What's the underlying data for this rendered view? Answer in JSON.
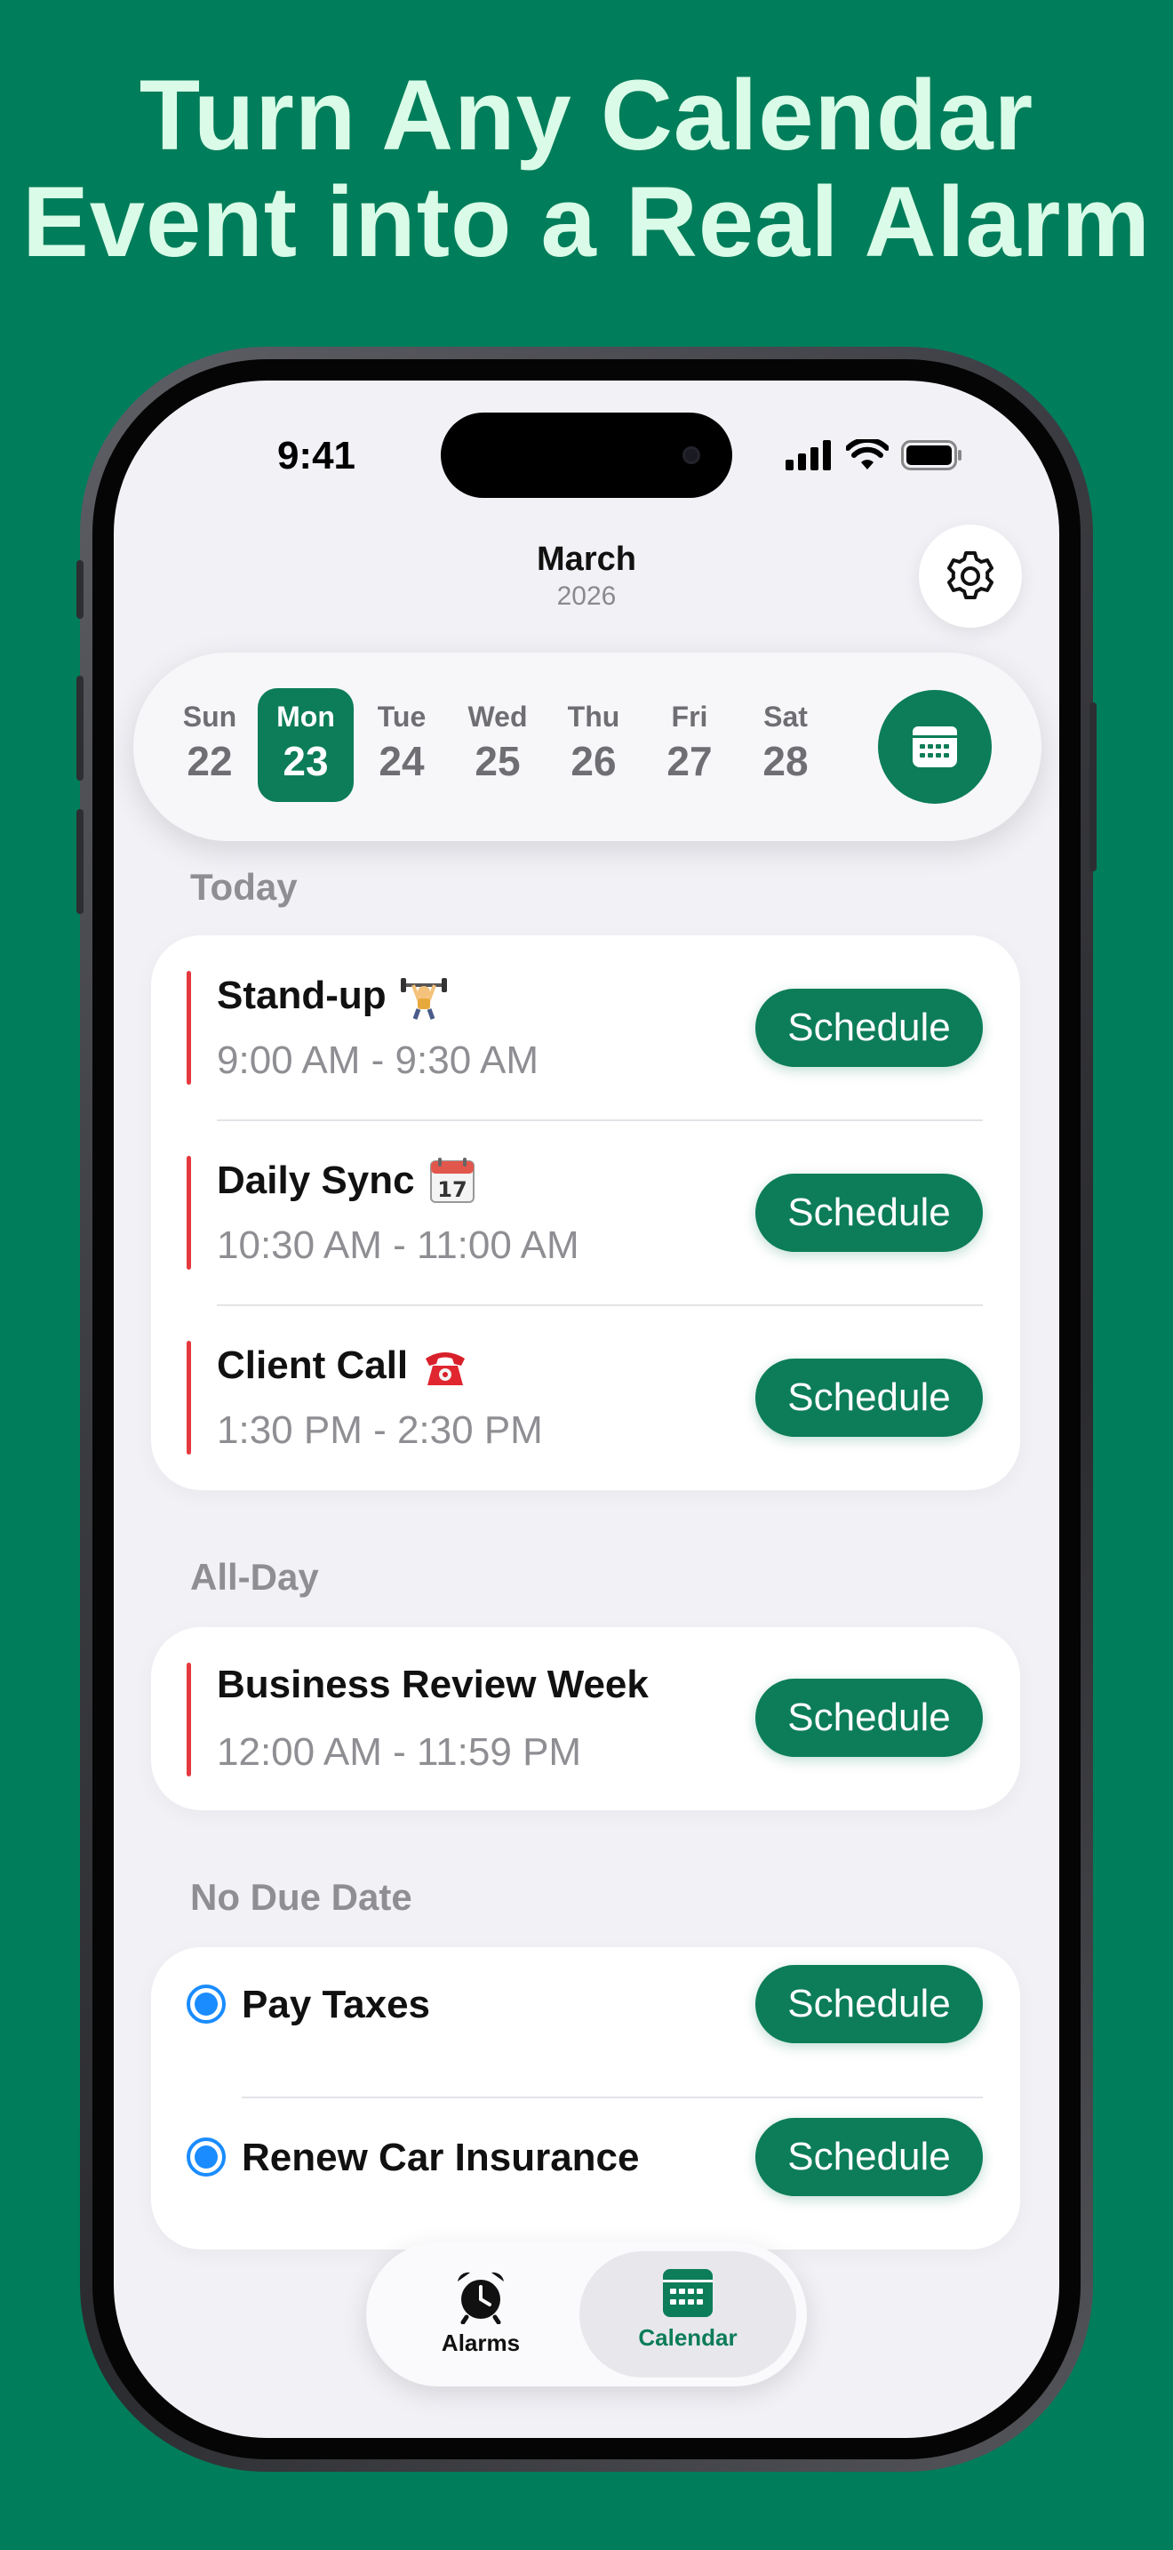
{
  "headline": {
    "line1": "Turn Any Calendar",
    "line2": "Event into a Real Alarm"
  },
  "status_bar": {
    "time": "9:41"
  },
  "header": {
    "month": "March",
    "year": "2026",
    "settings_icon": "gear-icon"
  },
  "week": {
    "days": [
      {
        "name": "Sun",
        "num": "22",
        "selected": false
      },
      {
        "name": "Mon",
        "num": "23",
        "selected": true
      },
      {
        "name": "Tue",
        "num": "24",
        "selected": false
      },
      {
        "name": "Wed",
        "num": "25",
        "selected": false
      },
      {
        "name": "Thu",
        "num": "26",
        "selected": false
      },
      {
        "name": "Fri",
        "num": "27",
        "selected": false
      },
      {
        "name": "Sat",
        "num": "28",
        "selected": false
      }
    ],
    "calendar_icon": "calendar-icon"
  },
  "sections": {
    "today": {
      "label": "Today",
      "events": [
        {
          "title": "Stand-up",
          "icon": "weightlifter-emoji",
          "time": "9:00 AM  -  9:30 AM",
          "button": "Schedule"
        },
        {
          "title": "Daily Sync",
          "icon": "calendar-17-emoji",
          "time": "10:30 AM  -  11:00 AM",
          "button": "Schedule"
        },
        {
          "title": "Client Call",
          "icon": "telephone-emoji",
          "time": "1:30 PM  -  2:30 PM",
          "button": "Schedule"
        }
      ]
    },
    "all_day": {
      "label": "All-Day",
      "events": [
        {
          "title": "Business Review Week",
          "time": "12:00 AM  -  11:59 PM",
          "button": "Schedule"
        }
      ]
    },
    "no_due_date": {
      "label": "No Due Date",
      "tasks": [
        {
          "title": "Pay Taxes",
          "button": "Schedule"
        },
        {
          "title": "Renew Car Insurance",
          "button": "Schedule"
        }
      ]
    }
  },
  "tabbar": {
    "tabs": [
      {
        "label": "Alarms",
        "icon": "alarm-clock-icon",
        "active": false
      },
      {
        "label": "Calendar",
        "icon": "calendar-icon",
        "active": true
      }
    ]
  },
  "colors": {
    "background": "#007d5a",
    "headline": "#d9fbe7",
    "accent": "#0c7d58",
    "event_bar": "#e5393f",
    "task_radio": "#1a8cff"
  }
}
